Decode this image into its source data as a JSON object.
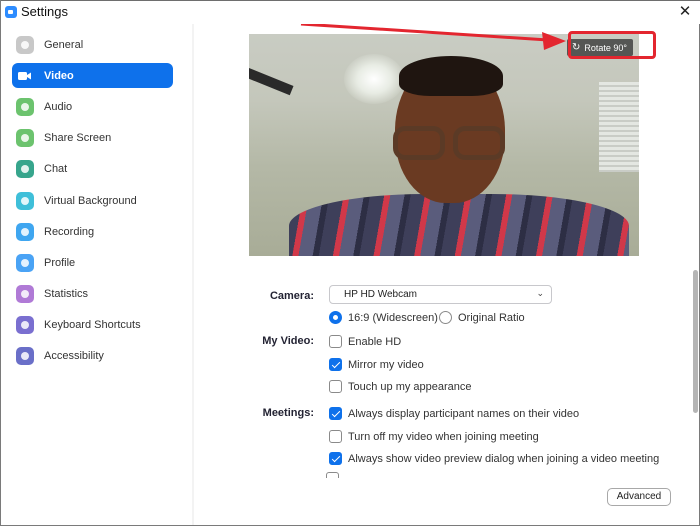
{
  "window": {
    "title": "Settings",
    "close_glyph": "✕"
  },
  "sidebar": {
    "items": [
      {
        "label": "General",
        "icon": "gear-icon",
        "color": "#c8c8c8",
        "active": false
      },
      {
        "label": "Video",
        "icon": "video-camera-icon",
        "color": "#ffffff",
        "active": true
      },
      {
        "label": "Audio",
        "icon": "headphones-icon",
        "color": "#6cc36e",
        "active": false
      },
      {
        "label": "Share Screen",
        "icon": "share-screen-icon",
        "color": "#6cc36e",
        "active": false
      },
      {
        "label": "Chat",
        "icon": "chat-bubble-icon",
        "color": "#37a58c",
        "active": false
      },
      {
        "label": "Virtual Background",
        "icon": "virtual-background-icon",
        "color": "#3fbfd9",
        "active": false
      },
      {
        "label": "Recording",
        "icon": "record-icon",
        "color": "#3fa6f0",
        "active": false
      },
      {
        "label": "Profile",
        "icon": "person-icon",
        "color": "#4aa3f5",
        "active": false
      },
      {
        "label": "Statistics",
        "icon": "bar-chart-icon",
        "color": "#b07ad6",
        "active": false
      },
      {
        "label": "Keyboard Shortcuts",
        "icon": "keyboard-icon",
        "color": "#7a6fd0",
        "active": false
      },
      {
        "label": "Accessibility",
        "icon": "accessibility-icon",
        "color": "#6a6fc8",
        "active": false
      }
    ]
  },
  "video": {
    "rotate_label": "Rotate 90°",
    "rotate_icon": "↻",
    "camera": {
      "label": "Camera:",
      "selected": "HP HD Webcam",
      "chevron": "⌄"
    },
    "aspect": {
      "options": [
        {
          "label": "16:9 (Widescreen)",
          "checked": true
        },
        {
          "label": "Original Ratio",
          "checked": false
        }
      ]
    },
    "my_video": {
      "label": "My Video:",
      "options": [
        {
          "label": "Enable HD",
          "checked": false
        },
        {
          "label": "Mirror my video",
          "checked": true
        },
        {
          "label": "Touch up my appearance",
          "checked": false
        }
      ]
    },
    "meetings": {
      "label": "Meetings:",
      "options": [
        {
          "label": "Always display participant names on their video",
          "checked": true
        },
        {
          "label": "Turn off my video when joining meeting",
          "checked": false
        },
        {
          "label": "Always show video preview dialog when joining a video meeting",
          "checked": true
        }
      ]
    },
    "advanced_label": "Advanced"
  },
  "colors": {
    "accent": "#0e71eb",
    "annotation": "#e3262f"
  }
}
